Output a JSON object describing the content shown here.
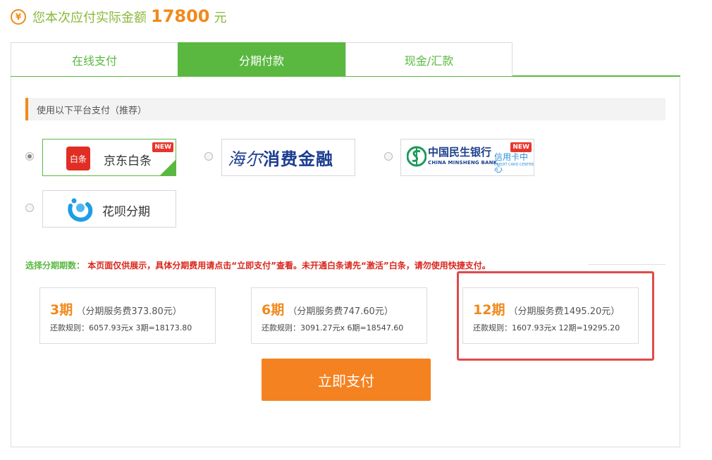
{
  "header": {
    "icon": "yen-circle-icon",
    "label": "您本次应付实际金额",
    "amount": "17800",
    "unit": "元"
  },
  "tabs": [
    {
      "label": "在线支付",
      "active": false
    },
    {
      "label": "分期付款",
      "active": true
    },
    {
      "label": "现金/汇款",
      "active": false
    }
  ],
  "section_title": "使用以下平台支付（推荐）",
  "platforms": [
    {
      "id": "jd-baitiao",
      "logo_text": "白条",
      "name": "京东白条",
      "badge": "NEW",
      "selected": true
    },
    {
      "id": "haier",
      "name": "海尔消费金融",
      "name_script": "海尔",
      "name_bold": "消费金融",
      "selected": false
    },
    {
      "id": "cmbc",
      "name_cn": "中国民生银行",
      "name_en": "CHINA MINSHENG BANK",
      "sub": "信用卡中心",
      "sub_en": "CREDIT CARD CENTER",
      "badge": "NEW",
      "selected": false
    },
    {
      "id": "huabei",
      "name": "花呗分期",
      "selected": false
    }
  ],
  "installment": {
    "label": "选择分期期数：",
    "notice": "本页面仅供展示，具体分期费用请点击“立即支付”查看。未开通白条请先“激活”白条，请勿使用快捷支付。",
    "options": [
      {
        "period": "3期",
        "fee": "（分期服务费373.80元）",
        "rule": "还款规则：6057.93元x 3期=18173.80"
      },
      {
        "period": "6期",
        "fee": "（分期服务费747.60元）",
        "rule": "还款规则：3091.27元x 6期=18547.60"
      },
      {
        "period": "12期",
        "fee": "（分期服务费1495.20元）",
        "rule": "还款规则：1607.93元x 12期=19295.20"
      }
    ]
  },
  "submit_label": "立即支付",
  "colors": {
    "accent_green": "#5ab840",
    "accent_orange": "#f08a1c",
    "button_orange": "#f58220",
    "notice_red": "#d9261c",
    "highlight_red": "#e04a4a"
  }
}
